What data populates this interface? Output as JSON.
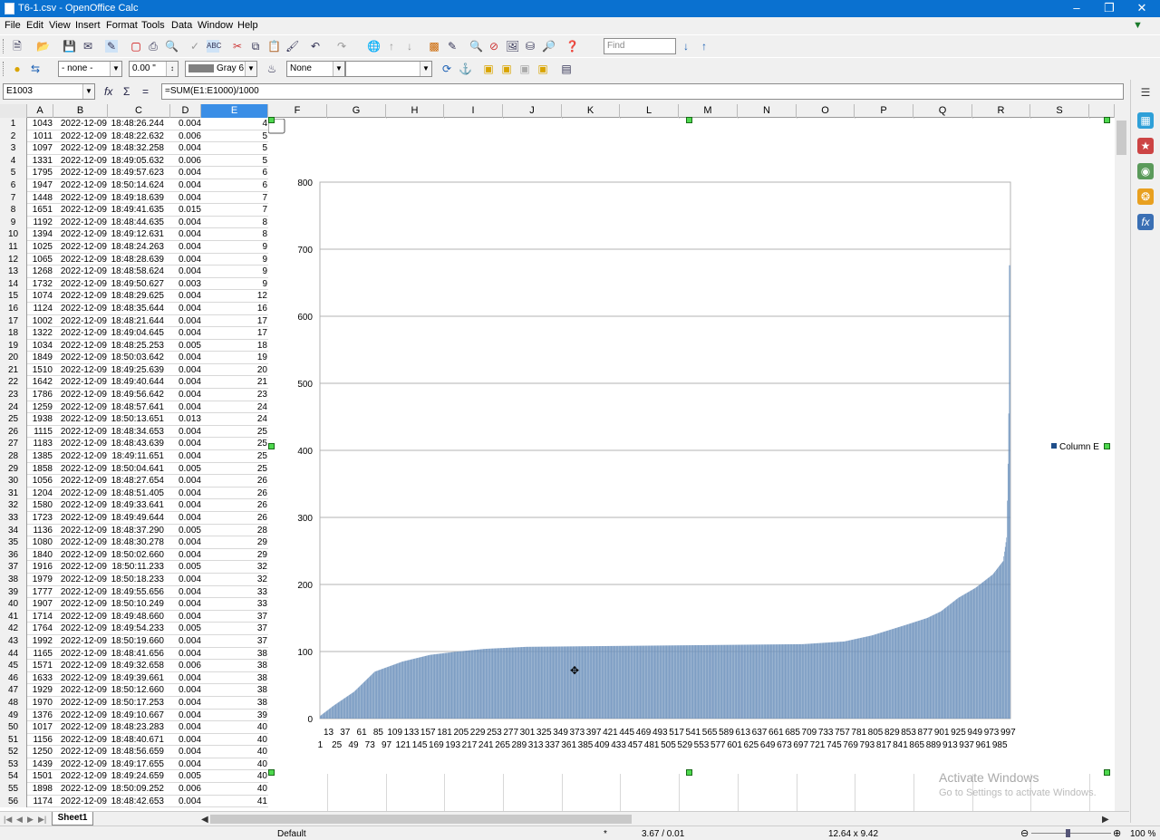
{
  "window": {
    "title": "T6-1.csv - OpenOffice Calc"
  },
  "menu": [
    "File",
    "Edit",
    "View",
    "Insert",
    "Format",
    "Tools",
    "Data",
    "Window",
    "Help"
  ],
  "toolbar": {
    "find_placeholder": "Find"
  },
  "toolbar2": {
    "line_style": "- none -",
    "line_width": "0.00 \"",
    "color": "Gray 6",
    "area_style": "None",
    "area_fill": ""
  },
  "formula_bar": {
    "cell_ref": "E1003",
    "formula": "=SUM(E1:E1000)/1000"
  },
  "columns": [
    "A",
    "B",
    "C",
    "D",
    "E",
    "F",
    "G",
    "H",
    "I",
    "J",
    "K",
    "L",
    "M",
    "N",
    "O",
    "P",
    "Q",
    "R",
    "S"
  ],
  "rows": [
    {
      "n": "1",
      "a": "1043",
      "b": "2022-12-09",
      "c": "18:48:26.244",
      "d": "0.004",
      "e": "4"
    },
    {
      "n": "2",
      "a": "1011",
      "b": "2022-12-09",
      "c": "18:48:22.632",
      "d": "0.006",
      "e": "5"
    },
    {
      "n": "3",
      "a": "1097",
      "b": "2022-12-09",
      "c": "18:48:32.258",
      "d": "0.004",
      "e": "5"
    },
    {
      "n": "4",
      "a": "1331",
      "b": "2022-12-09",
      "c": "18:49:05.632",
      "d": "0.006",
      "e": "5"
    },
    {
      "n": "5",
      "a": "1795",
      "b": "2022-12-09",
      "c": "18:49:57.623",
      "d": "0.004",
      "e": "6"
    },
    {
      "n": "6",
      "a": "1947",
      "b": "2022-12-09",
      "c": "18:50:14.624",
      "d": "0.004",
      "e": "6"
    },
    {
      "n": "7",
      "a": "1448",
      "b": "2022-12-09",
      "c": "18:49:18.639",
      "d": "0.004",
      "e": "7"
    },
    {
      "n": "8",
      "a": "1651",
      "b": "2022-12-09",
      "c": "18:49:41.635",
      "d": "0.015",
      "e": "7"
    },
    {
      "n": "9",
      "a": "1192",
      "b": "2022-12-09",
      "c": "18:48:44.635",
      "d": "0.004",
      "e": "8"
    },
    {
      "n": "10",
      "a": "1394",
      "b": "2022-12-09",
      "c": "18:49:12.631",
      "d": "0.004",
      "e": "8"
    },
    {
      "n": "11",
      "a": "1025",
      "b": "2022-12-09",
      "c": "18:48:24.263",
      "d": "0.004",
      "e": "9"
    },
    {
      "n": "12",
      "a": "1065",
      "b": "2022-12-09",
      "c": "18:48:28.639",
      "d": "0.004",
      "e": "9"
    },
    {
      "n": "13",
      "a": "1268",
      "b": "2022-12-09",
      "c": "18:48:58.624",
      "d": "0.004",
      "e": "9"
    },
    {
      "n": "14",
      "a": "1732",
      "b": "2022-12-09",
      "c": "18:49:50.627",
      "d": "0.003",
      "e": "9"
    },
    {
      "n": "15",
      "a": "1074",
      "b": "2022-12-09",
      "c": "18:48:29.625",
      "d": "0.004",
      "e": "12"
    },
    {
      "n": "16",
      "a": "1124",
      "b": "2022-12-09",
      "c": "18:48:35.644",
      "d": "0.004",
      "e": "16"
    },
    {
      "n": "17",
      "a": "1002",
      "b": "2022-12-09",
      "c": "18:48:21.644",
      "d": "0.004",
      "e": "17"
    },
    {
      "n": "18",
      "a": "1322",
      "b": "2022-12-09",
      "c": "18:49:04.645",
      "d": "0.004",
      "e": "17"
    },
    {
      "n": "19",
      "a": "1034",
      "b": "2022-12-09",
      "c": "18:48:25.253",
      "d": "0.005",
      "e": "18"
    },
    {
      "n": "20",
      "a": "1849",
      "b": "2022-12-09",
      "c": "18:50:03.642",
      "d": "0.004",
      "e": "19"
    },
    {
      "n": "21",
      "a": "1510",
      "b": "2022-12-09",
      "c": "18:49:25.639",
      "d": "0.004",
      "e": "20"
    },
    {
      "n": "22",
      "a": "1642",
      "b": "2022-12-09",
      "c": "18:49:40.644",
      "d": "0.004",
      "e": "21"
    },
    {
      "n": "23",
      "a": "1786",
      "b": "2022-12-09",
      "c": "18:49:56.642",
      "d": "0.004",
      "e": "23"
    },
    {
      "n": "24",
      "a": "1259",
      "b": "2022-12-09",
      "c": "18:48:57.641",
      "d": "0.004",
      "e": "24"
    },
    {
      "n": "25",
      "a": "1938",
      "b": "2022-12-09",
      "c": "18:50:13.651",
      "d": "0.013",
      "e": "24"
    },
    {
      "n": "26",
      "a": "1115",
      "b": "2022-12-09",
      "c": "18:48:34.653",
      "d": "0.004",
      "e": "25"
    },
    {
      "n": "27",
      "a": "1183",
      "b": "2022-12-09",
      "c": "18:48:43.639",
      "d": "0.004",
      "e": "25"
    },
    {
      "n": "28",
      "a": "1385",
      "b": "2022-12-09",
      "c": "18:49:11.651",
      "d": "0.004",
      "e": "25"
    },
    {
      "n": "29",
      "a": "1858",
      "b": "2022-12-09",
      "c": "18:50:04.641",
      "d": "0.005",
      "e": "25"
    },
    {
      "n": "30",
      "a": "1056",
      "b": "2022-12-09",
      "c": "18:48:27.654",
      "d": "0.004",
      "e": "26"
    },
    {
      "n": "31",
      "a": "1204",
      "b": "2022-12-09",
      "c": "18:48:51.405",
      "d": "0.004",
      "e": "26"
    },
    {
      "n": "32",
      "a": "1580",
      "b": "2022-12-09",
      "c": "18:49:33.641",
      "d": "0.004",
      "e": "26"
    },
    {
      "n": "33",
      "a": "1723",
      "b": "2022-12-09",
      "c": "18:49:49.644",
      "d": "0.004",
      "e": "26"
    },
    {
      "n": "34",
      "a": "1136",
      "b": "2022-12-09",
      "c": "18:48:37.290",
      "d": "0.005",
      "e": "28"
    },
    {
      "n": "35",
      "a": "1080",
      "b": "2022-12-09",
      "c": "18:48:30.278",
      "d": "0.004",
      "e": "29"
    },
    {
      "n": "36",
      "a": "1840",
      "b": "2022-12-09",
      "c": "18:50:02.660",
      "d": "0.004",
      "e": "29"
    },
    {
      "n": "37",
      "a": "1916",
      "b": "2022-12-09",
      "c": "18:50:11.233",
      "d": "0.005",
      "e": "32"
    },
    {
      "n": "38",
      "a": "1979",
      "b": "2022-12-09",
      "c": "18:50:18.233",
      "d": "0.004",
      "e": "32"
    },
    {
      "n": "39",
      "a": "1777",
      "b": "2022-12-09",
      "c": "18:49:55.656",
      "d": "0.004",
      "e": "33"
    },
    {
      "n": "40",
      "a": "1907",
      "b": "2022-12-09",
      "c": "18:50:10.249",
      "d": "0.004",
      "e": "33"
    },
    {
      "n": "41",
      "a": "1714",
      "b": "2022-12-09",
      "c": "18:49:48.660",
      "d": "0.004",
      "e": "37"
    },
    {
      "n": "42",
      "a": "1764",
      "b": "2022-12-09",
      "c": "18:49:54.233",
      "d": "0.005",
      "e": "37"
    },
    {
      "n": "43",
      "a": "1992",
      "b": "2022-12-09",
      "c": "18:50:19.660",
      "d": "0.004",
      "e": "37"
    },
    {
      "n": "44",
      "a": "1165",
      "b": "2022-12-09",
      "c": "18:48:41.656",
      "d": "0.004",
      "e": "38"
    },
    {
      "n": "45",
      "a": "1571",
      "b": "2022-12-09",
      "c": "18:49:32.658",
      "d": "0.006",
      "e": "38"
    },
    {
      "n": "46",
      "a": "1633",
      "b": "2022-12-09",
      "c": "18:49:39.661",
      "d": "0.004",
      "e": "38"
    },
    {
      "n": "47",
      "a": "1929",
      "b": "2022-12-09",
      "c": "18:50:12.660",
      "d": "0.004",
      "e": "38"
    },
    {
      "n": "48",
      "a": "1970",
      "b": "2022-12-09",
      "c": "18:50:17.253",
      "d": "0.004",
      "e": "38"
    },
    {
      "n": "49",
      "a": "1376",
      "b": "2022-12-09",
      "c": "18:49:10.667",
      "d": "0.004",
      "e": "39"
    },
    {
      "n": "50",
      "a": "1017",
      "b": "2022-12-09",
      "c": "18:48:23.283",
      "d": "0.004",
      "e": "40"
    },
    {
      "n": "51",
      "a": "1156",
      "b": "2022-12-09",
      "c": "18:48:40.671",
      "d": "0.004",
      "e": "40"
    },
    {
      "n": "52",
      "a": "1250",
      "b": "2022-12-09",
      "c": "18:48:56.659",
      "d": "0.004",
      "e": "40"
    },
    {
      "n": "53",
      "a": "1439",
      "b": "2022-12-09",
      "c": "18:49:17.655",
      "d": "0.004",
      "e": "40"
    },
    {
      "n": "54",
      "a": "1501",
      "b": "2022-12-09",
      "c": "18:49:24.659",
      "d": "0.005",
      "e": "40"
    },
    {
      "n": "55",
      "a": "1898",
      "b": "2022-12-09",
      "c": "18:50:09.252",
      "d": "0.006",
      "e": "40"
    },
    {
      "n": "56",
      "a": "1174",
      "b": "2022-12-09",
      "c": "18:48:42.653",
      "d": "0.004",
      "e": "41"
    }
  ],
  "chart_data": {
    "type": "bar",
    "title": "",
    "xlabel": "",
    "ylabel": "",
    "ylim": [
      0,
      800
    ],
    "yticks": [
      0,
      100,
      200,
      300,
      400,
      500,
      600,
      700,
      800
    ],
    "xticks_row1": [
      "13",
      "37",
      "61",
      "85",
      "109",
      "133",
      "157",
      "181",
      "205",
      "229",
      "253",
      "277",
      "301",
      "325",
      "349",
      "373",
      "397",
      "421",
      "445",
      "469",
      "493",
      "517",
      "541",
      "565",
      "589",
      "613",
      "637",
      "661",
      "685",
      "709",
      "733",
      "757",
      "781",
      "805",
      "829",
      "853",
      "877",
      "901",
      "925",
      "949",
      "973",
      "997"
    ],
    "xticks_row2": [
      "1",
      "25",
      "49",
      "73",
      "97",
      "121",
      "145",
      "169",
      "193",
      "217",
      "241",
      "265",
      "289",
      "313",
      "337",
      "361",
      "385",
      "409",
      "433",
      "457",
      "481",
      "505",
      "529",
      "553",
      "577",
      "601",
      "625",
      "649",
      "673",
      "697",
      "721",
      "745",
      "769",
      "793",
      "817",
      "841",
      "865",
      "889",
      "913",
      "937",
      "961",
      "985"
    ],
    "x_range": [
      1,
      1000
    ],
    "grid": true,
    "legend": "right",
    "color": "#6f93bd",
    "series": [
      {
        "name": "Column E",
        "profile_x": [
          1,
          20,
          50,
          80,
          120,
          160,
          200,
          240,
          300,
          400,
          500,
          600,
          700,
          760,
          800,
          850,
          880,
          900,
          925,
          950,
          975,
          990,
          995,
          997,
          998,
          999,
          1000
        ],
        "profile_y": [
          4,
          19,
          40,
          70,
          85,
          95,
          100,
          104,
          107,
          108,
          109,
          110,
          111,
          115,
          124,
          140,
          150,
          160,
          180,
          195,
          215,
          235,
          270,
          380,
          455,
          676,
          676
        ]
      }
    ]
  },
  "sheets": [
    "Sheet1"
  ],
  "status": {
    "page_style": "Default",
    "mode": "*",
    "position": "3.67 / 0.01",
    "size": "12.64 x 9.42",
    "zoom": "100 %"
  },
  "watermark": {
    "line1": "Activate Windows",
    "line2": "Go to Settings to activate Windows."
  }
}
